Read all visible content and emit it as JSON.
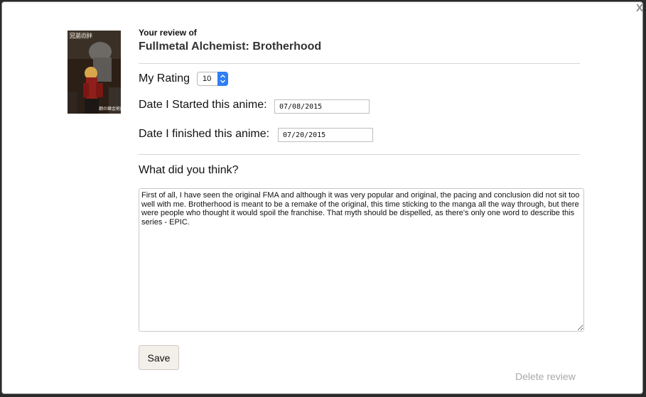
{
  "dialog": {
    "close_label": "X",
    "review_of_label": "Your review of",
    "anime_title": "Fullmetal Alchemist: Brotherhood",
    "poster": {
      "title_text": "兄弟の絆",
      "bottom_text": "鋼の錬金術師"
    }
  },
  "form": {
    "rating_label": "My Rating",
    "rating_value": "10",
    "started_label": "Date I Started this anime:",
    "started_value": "07/08/2015",
    "finished_label": "Date I finished this anime:",
    "finished_value": "07/20/2015",
    "thoughts_label": "What did you think?",
    "review_text": "First of all, I have seen the original FMA and although it was very popular and original, the pacing and conclusion did not sit too well with me. Brotherhood is meant to be a remake of the original, this time sticking to the manga all the way through, but there were people who thought it would spoil the franchise. That myth should be dispelled, as there's only one word to describe this series - EPIC.",
    "save_label": "Save",
    "delete_label": "Delete review"
  },
  "colors": {
    "accent": "#2f7ef5",
    "delete_text": "#a8a8a8"
  }
}
